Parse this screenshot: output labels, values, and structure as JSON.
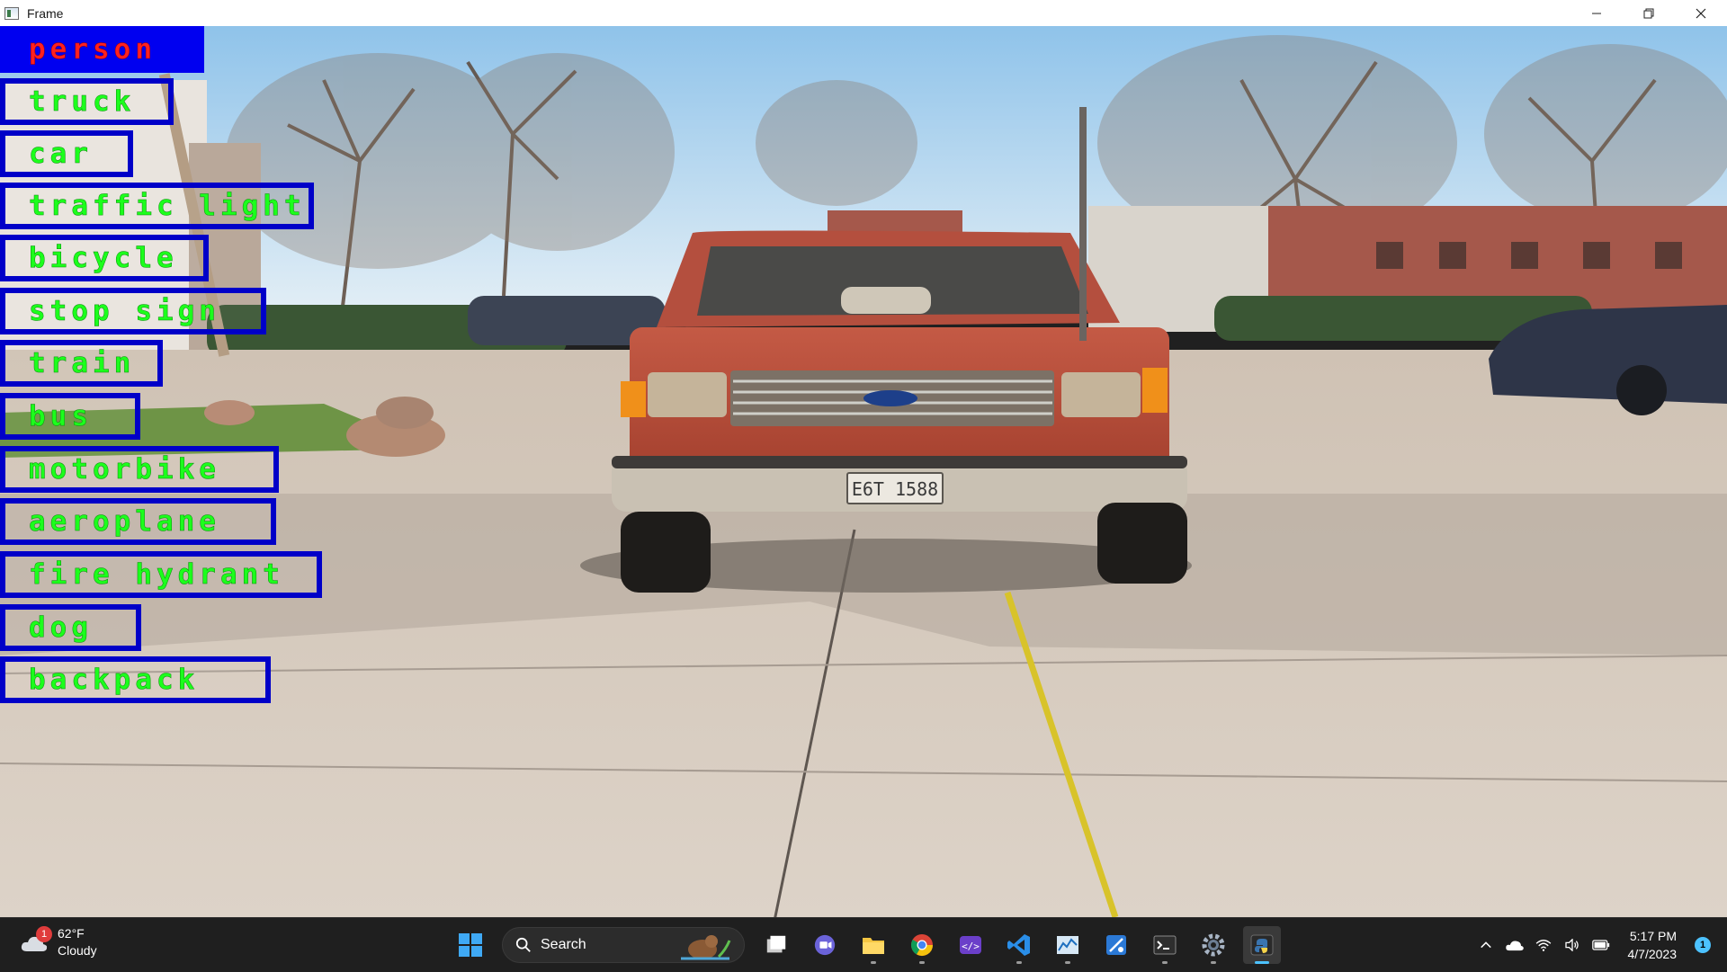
{
  "window": {
    "title": "Frame",
    "controls": [
      "minimize-icon",
      "restore-icon",
      "close-icon"
    ]
  },
  "frame": {
    "plate_text": "E6T 1588",
    "classes": [
      {
        "label": "person",
        "selected": true
      },
      {
        "label": "truck",
        "selected": false
      },
      {
        "label": "car",
        "selected": false
      },
      {
        "label": "traffic light",
        "selected": false
      },
      {
        "label": "bicycle",
        "selected": false
      },
      {
        "label": "stop sign",
        "selected": false
      },
      {
        "label": "train",
        "selected": false
      },
      {
        "label": "bus",
        "selected": false
      },
      {
        "label": "motorbike",
        "selected": false
      },
      {
        "label": "aeroplane",
        "selected": false
      },
      {
        "label": "fire hydrant",
        "selected": false
      },
      {
        "label": "dog",
        "selected": false
      },
      {
        "label": "backpack",
        "selected": false
      }
    ],
    "colors": {
      "box_border": "#0000c8",
      "label_text": "#1cff1c",
      "selected_bg": "#0000f0",
      "selected_text": "#ff2020"
    }
  },
  "taskbar": {
    "weather": {
      "temp": "62°F",
      "condition": "Cloudy",
      "badge": "1"
    },
    "search_label": "Search",
    "apps": [
      "windows-start-icon",
      "search-box",
      "task-view-icon",
      "teams-icon",
      "file-explorer-icon",
      "chrome-icon",
      "dev-home-icon",
      "vscode-icon",
      "resource-monitor-icon",
      "snip-icon",
      "terminal-icon",
      "settings-icon",
      "python-icon"
    ],
    "tray": {
      "time": "5:17 PM",
      "date": "4/7/2023",
      "notifications": "1"
    }
  }
}
